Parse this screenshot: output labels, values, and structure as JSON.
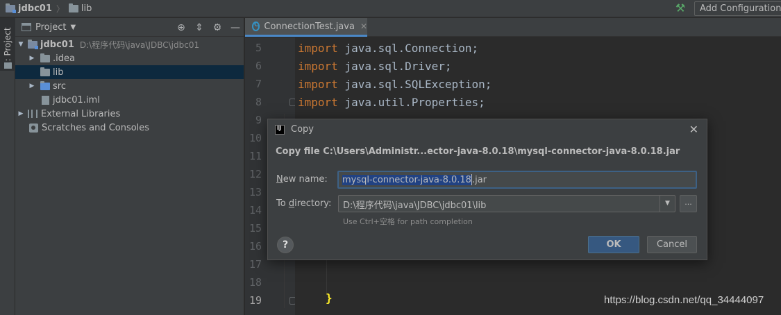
{
  "navbar": {
    "project_name": "jdbc01",
    "folder_name": "lib",
    "add_config_label": "Add Configuration..."
  },
  "toolstrip": {
    "project_tab_label": "1: Project"
  },
  "project_panel": {
    "title": "Project",
    "tree": [
      {
        "label": "jdbc01",
        "path": "D:\\程序代码\\java\\JDBC\\jdbc01",
        "expanded": true
      },
      {
        "label": ".idea"
      },
      {
        "label": "lib",
        "selected": true
      },
      {
        "label": "src"
      },
      {
        "label": "jdbc01.iml"
      },
      {
        "label": "External Libraries"
      },
      {
        "label": "Scratches and Consoles"
      }
    ]
  },
  "editor": {
    "tab_label": "ConnectionTest.java",
    "line_numbers": [
      "5",
      "6",
      "7",
      "8",
      "9",
      "10",
      "11",
      "12",
      "13",
      "14",
      "15",
      "16",
      "17",
      "18",
      "19"
    ],
    "code": [
      {
        "kw": "import",
        "rest": " java.sql.Connection;"
      },
      {
        "kw": "import",
        "rest": " java.sql.Driver;"
      },
      {
        "kw": "import",
        "rest": " java.sql.SQLException;"
      },
      {
        "kw": "import",
        "rest": " java.util.Properties;"
      }
    ],
    "closing_brace": "}"
  },
  "dialog": {
    "title": "Copy",
    "heading": "Copy file C:\\Users\\Administr...ector-java-8.0.18\\mysql-connector-java-8.0.18.jar",
    "new_name_label_u": "N",
    "new_name_label_rest": "ew name:",
    "new_name_selected": "mysql-connector-java-8.0.18",
    "new_name_rest": ".jar",
    "to_dir_label_pre": "To ",
    "to_dir_label_u": "d",
    "to_dir_label_rest": "irectory:",
    "directory_value": "D:\\程序代码\\java\\JDBC\\jdbc01\\lib",
    "hint": "Use Ctrl+空格 for path completion",
    "browse_label": "...",
    "help_label": "?",
    "ok_label": "OK",
    "cancel_label": "Cancel"
  },
  "watermark": "https://blog.csdn.net/qq_34444097",
  "colors": {
    "keyword": "#cc7832",
    "identifier": "#a9b7c6",
    "selection": "#0d293e",
    "ok_button": "#365880",
    "accent_tab": "#4a88c7"
  }
}
